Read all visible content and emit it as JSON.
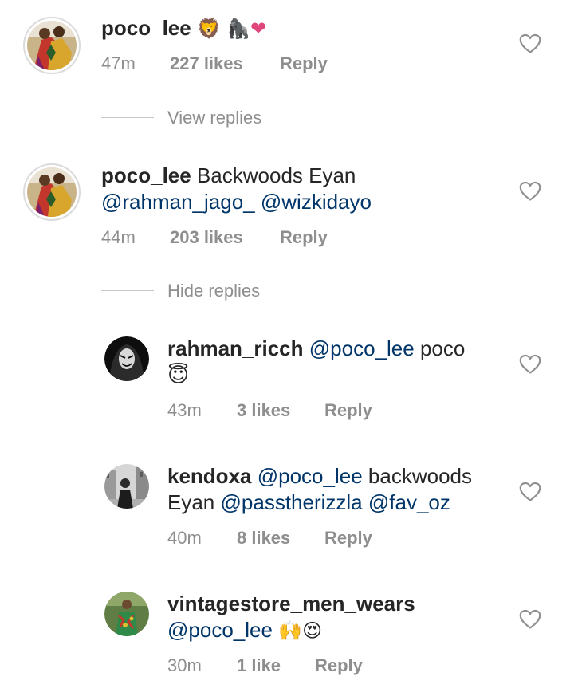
{
  "comments": [
    {
      "username": "poco_lee",
      "emojis": [
        "🦁",
        "🦍",
        "❤"
      ],
      "time": "47m",
      "likes": "227 likes",
      "reply_label": "Reply",
      "replies_toggle": "View replies"
    },
    {
      "username": "poco_lee",
      "text": "Backwoods Eyan",
      "mentions": [
        "@rahman_jago_",
        "@wizkidayo"
      ],
      "time": "44m",
      "likes": "203 likes",
      "reply_label": "Reply",
      "replies_toggle": "Hide replies",
      "replies": [
        {
          "username": "rahman_ricch",
          "mention": "@poco_lee",
          "text": "poco",
          "emoji": "😇",
          "time": "43m",
          "likes": "3 likes",
          "reply_label": "Reply"
        },
        {
          "username": "kendoxa",
          "mention": "@poco_lee",
          "text_1": "backwoods",
          "text_2": "Eyan",
          "mentions": [
            "@passtherizzla",
            "@fav_oz"
          ],
          "time": "40m",
          "likes": "8 likes",
          "reply_label": "Reply"
        },
        {
          "username": "vintagestore_men_wears",
          "mention": "@poco_lee",
          "emojis": [
            "🙌",
            "😍"
          ],
          "time": "30m",
          "likes": "1 like",
          "reply_label": "Reply"
        }
      ]
    }
  ],
  "colors": {
    "text": "#262626",
    "mention": "#003569",
    "meta": "#8e8e8e",
    "heart_outline": "#8e8e8e",
    "emoji_heart": "#e0457b"
  },
  "icons": {
    "like": "heart-outline-icon"
  }
}
